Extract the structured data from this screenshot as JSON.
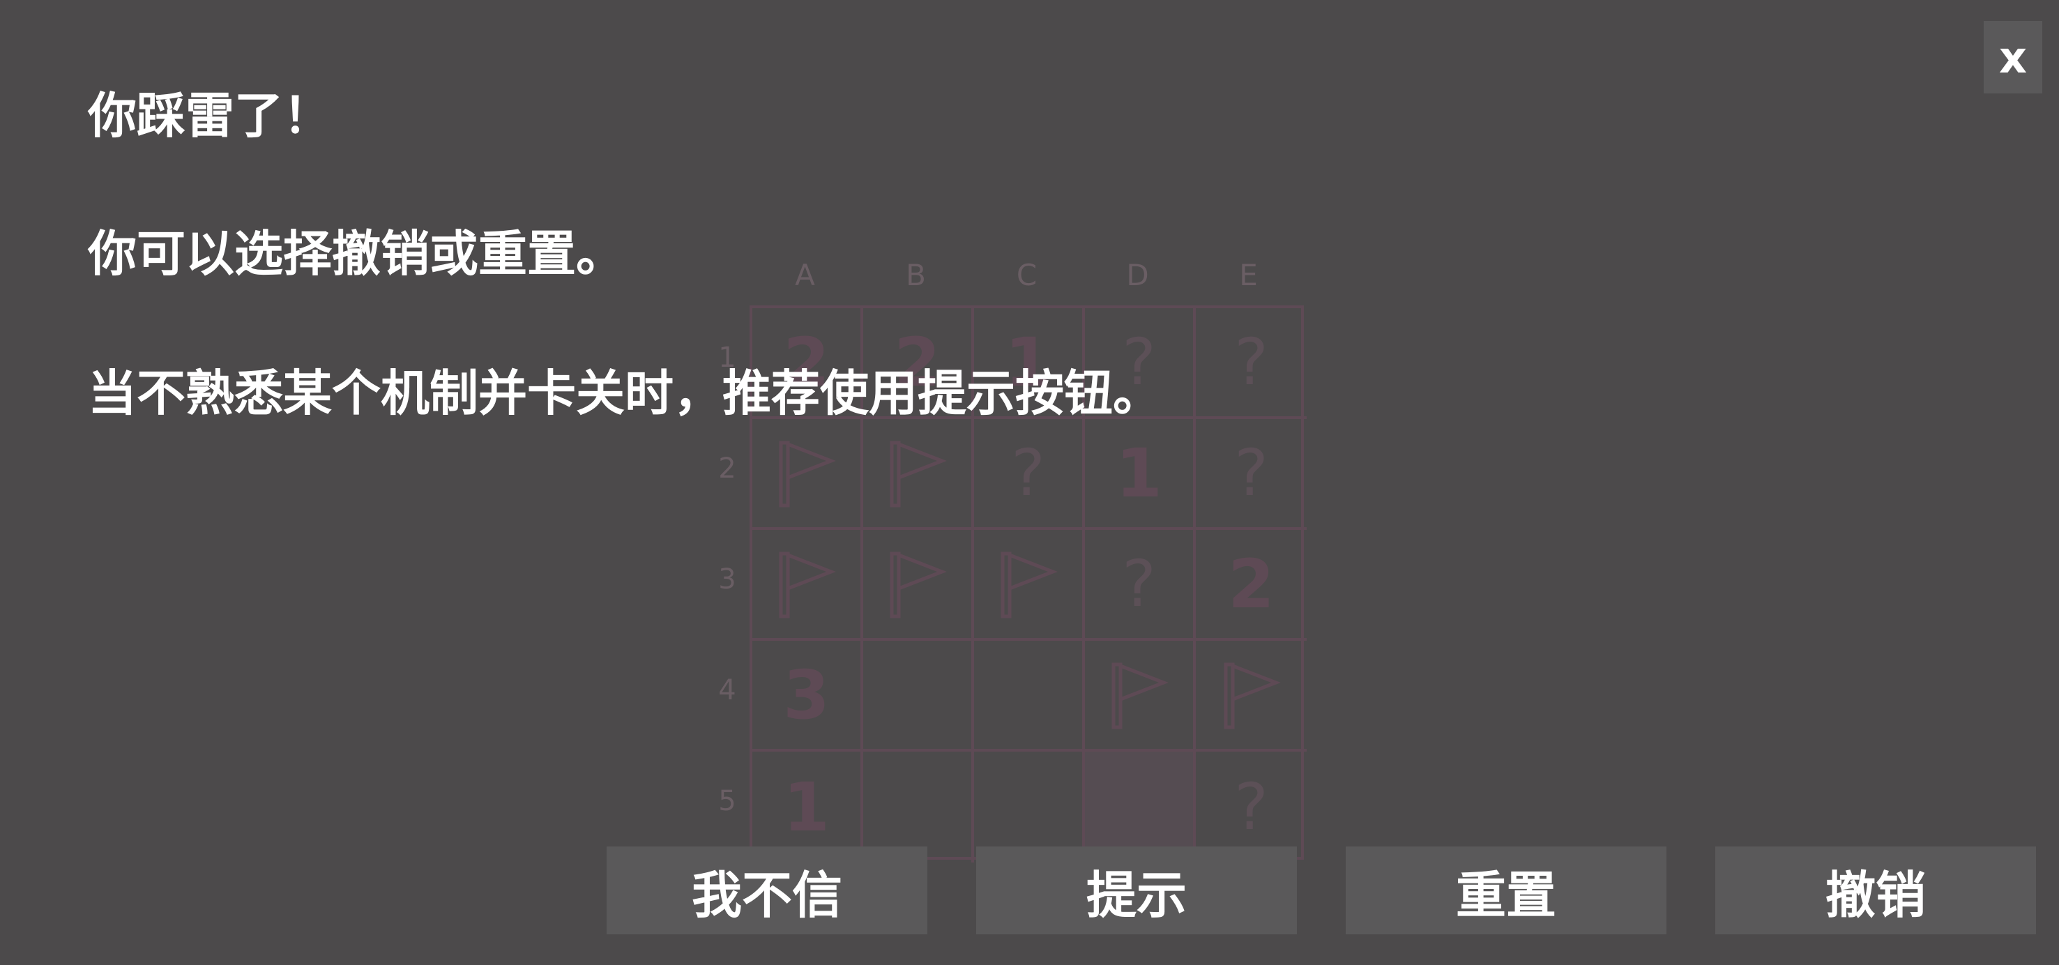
{
  "overlay": {
    "message_1": "你踩雷了！",
    "message_2": "你可以选择撤销或重置。",
    "message_3": "当不熟悉某个机制并卡关时，推荐使用提示按钮。",
    "close_label": "x"
  },
  "buttons": {
    "disbelieve": "我不信",
    "hint": "提示",
    "reset": "重置",
    "undo": "撤销"
  },
  "board": {
    "columns": [
      "A",
      "B",
      "C",
      "D",
      "E"
    ],
    "rows": [
      "1",
      "2",
      "3",
      "4",
      "5"
    ],
    "cells": [
      [
        "2",
        "2",
        "1",
        "?",
        "?"
      ],
      [
        "flag",
        "flag",
        "?",
        "1",
        "?"
      ],
      [
        "flag",
        "flag",
        "flag",
        "?",
        "2"
      ],
      [
        "3",
        "",
        "",
        "flag",
        "flag"
      ],
      [
        "1",
        "",
        "",
        "",
        "?"
      ]
    ]
  },
  "colors": {
    "background": "#4c4a4b",
    "button": "#5a595a",
    "text": "#ffffff",
    "board_line": "#5e4a55"
  }
}
